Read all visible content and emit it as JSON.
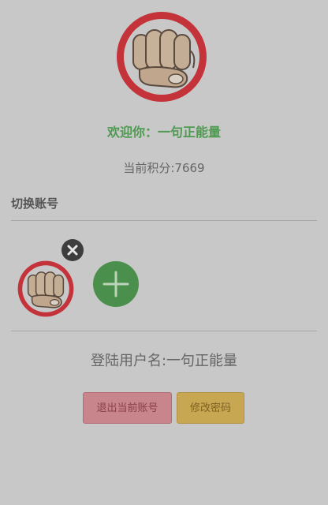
{
  "profile": {
    "welcome_text": "欢迎你：一句正能量",
    "points_text": "当前积分:7669",
    "avatar_icon": "fist-avatar-icon"
  },
  "accounts": {
    "section_title": "切换账号",
    "items": [
      {
        "avatar_icon": "fist-avatar-icon",
        "remove_icon": "close-icon"
      }
    ],
    "add_icon": "plus-icon"
  },
  "login": {
    "username_text": "登陆用户名:一句正能量"
  },
  "actions": {
    "logout_label": "退出当前账号",
    "change_password_label": "修改密码"
  },
  "colors": {
    "welcome_green": "#4f9a51",
    "add_button_green": "#4a8f4c",
    "avatar_ring_red": "#c7343a",
    "logout_button": "#c8858c",
    "change_password_button": "#c8a752"
  }
}
